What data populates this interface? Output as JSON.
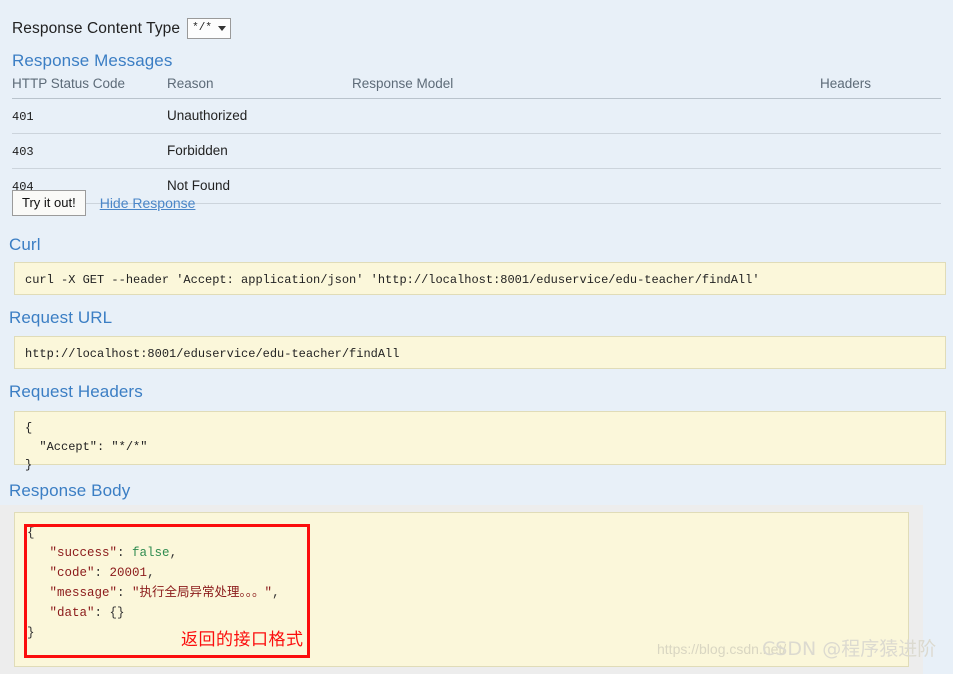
{
  "content_type": {
    "label": "Response Content Type",
    "selected": "*/*",
    "caret_icon": "chevron-down-icon"
  },
  "response_messages": {
    "heading": "Response Messages",
    "columns": [
      "HTTP Status Code",
      "Reason",
      "Response Model",
      "Headers"
    ],
    "rows": [
      {
        "status": "401",
        "reason": "Unauthorized",
        "model": "",
        "headers": ""
      },
      {
        "status": "403",
        "reason": "Forbidden",
        "model": "",
        "headers": ""
      },
      {
        "status": "404",
        "reason": "Not Found",
        "model": "",
        "headers": ""
      }
    ]
  },
  "actions": {
    "try_it_out": "Try it out!",
    "hide_response": "Hide Response"
  },
  "curl": {
    "heading": "Curl",
    "command": "curl -X GET --header 'Accept: application/json' 'http://localhost:8001/eduservice/edu-teacher/findAll'"
  },
  "request_url": {
    "heading": "Request URL",
    "url": "http://localhost:8001/eduservice/edu-teacher/findAll"
  },
  "request_headers": {
    "heading": "Request Headers",
    "body": "{\n  \"Accept\": \"*/*\"\n}"
  },
  "response_body": {
    "heading": "Response Body",
    "json": {
      "open_brace": "{",
      "lines": [
        {
          "key": "\"success\"",
          "sep": ": ",
          "value": "false",
          "value_kind": "bool",
          "comma": ","
        },
        {
          "key": "\"code\"",
          "sep": ": ",
          "value": "20001",
          "value_kind": "num",
          "comma": ","
        },
        {
          "key": "\"message\"",
          "sep": ": ",
          "value": "\"执行全局异常处理。。。\"",
          "value_kind": "str",
          "comma": ","
        },
        {
          "key": "\"data\"",
          "sep": ": ",
          "value": "{}",
          "value_kind": "pun",
          "comma": ""
        }
      ],
      "close_brace": "}"
    },
    "annotation": "返回的接口格式"
  },
  "watermark": {
    "url": "https://blog.csdn.net/",
    "brand": "CSDN @程序猿进阶"
  },
  "colors": {
    "page_background": "#e8f0f8",
    "heading_blue": "#3b7ec4",
    "code_background": "#fbf7da",
    "annotation_red": "#fb0d0d",
    "bool_green": "#2e8b4f",
    "key_maroon": "#8b1a1a"
  }
}
